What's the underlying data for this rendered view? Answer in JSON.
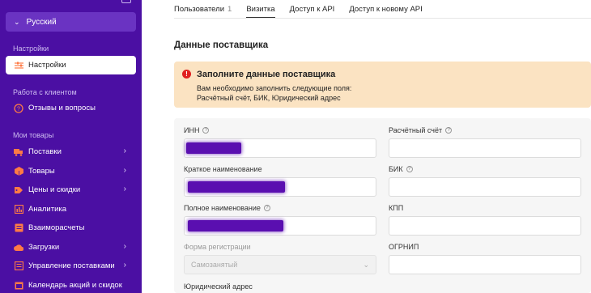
{
  "sidebar": {
    "language": "Русский",
    "sections": {
      "settings": "Настройки",
      "clients": "Работа с клиентом",
      "goods": "Мои товары"
    },
    "items": [
      {
        "label": "Настройки",
        "icon": "sliders-icon",
        "active": true
      },
      {
        "label": "Отзывы и вопросы",
        "icon": "question-circle-icon"
      },
      {
        "label": "Поставки",
        "icon": "truck-icon",
        "arrow": true
      },
      {
        "label": "Товары",
        "icon": "box-icon",
        "arrow": true
      },
      {
        "label": "Цены и скидки",
        "icon": "price-tag-icon",
        "arrow": true
      },
      {
        "label": "Аналитика",
        "icon": "chart-icon"
      },
      {
        "label": "Взаиморасчеты",
        "icon": "wallet-icon"
      },
      {
        "label": "Загрузки",
        "icon": "upload-icon",
        "arrow": true
      },
      {
        "label": "Управление поставками",
        "icon": "list-icon",
        "arrow": true
      },
      {
        "label": "Календарь акций и скидок",
        "icon": "calendar-icon"
      }
    ],
    "colors": {
      "background": "#4b0fa3",
      "accent_icon": "#ff7a45"
    }
  },
  "tabs": [
    {
      "label": "Пользователи",
      "count": "1"
    },
    {
      "label": "Визитка",
      "active": true
    },
    {
      "label": "Доступ к API"
    },
    {
      "label": "Доступ к новому API"
    }
  ],
  "section_title": "Данные поставщика",
  "alert": {
    "title": "Заполните данные поставщика",
    "line1": "Вам необходимо заполнить следующие поля:",
    "line2": "Расчётный счёт, БИК, Юридический адрес",
    "color": "#fbe3c2"
  },
  "form": {
    "inn_label": "ИНН",
    "account_label": "Расчётный счёт",
    "short_name_label": "Краткое наименование",
    "bik_label": "БИК",
    "full_name_label": "Полное наименование",
    "kpp_label": "КПП",
    "reg_form_label": "Форма регистрации",
    "reg_form_value": "Самозанятый",
    "ogrnip_label": "ОГРНИП",
    "legal_address_label": "Юридический адрес"
  }
}
